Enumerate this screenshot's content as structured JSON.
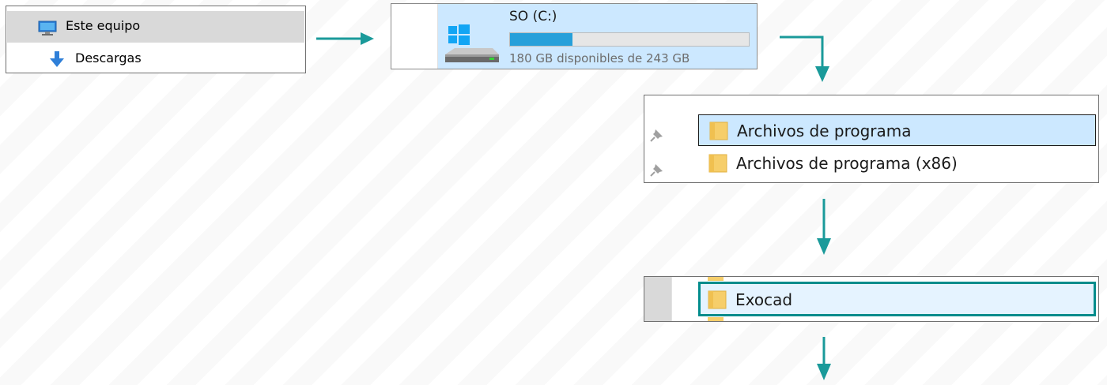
{
  "nav_pane": {
    "items": [
      {
        "label": "Este equipo",
        "icon": "computer-icon",
        "selected": true
      },
      {
        "label": "Descargas",
        "icon": "download-arrow-icon",
        "selected": false
      }
    ]
  },
  "drive": {
    "name": "SO (C:)",
    "free_text": "180 GB disponibles de 243 GB",
    "used_fraction": 0.26,
    "icon": "windows-drive-icon"
  },
  "folder_list": {
    "items": [
      {
        "label": "Archivos de programa",
        "selected": true,
        "pinned": true
      },
      {
        "label": "Archivos de programa (x86)",
        "selected": false,
        "pinned": true
      }
    ]
  },
  "target_folder": {
    "label": "Exocad",
    "highlighted": true
  },
  "colors": {
    "arrow": "#1a9a9a",
    "highlight_border": "#008c8c",
    "selection_blue": "#cce8ff",
    "usage_bar": "#26a0da",
    "folder": "#f6ce6a"
  }
}
